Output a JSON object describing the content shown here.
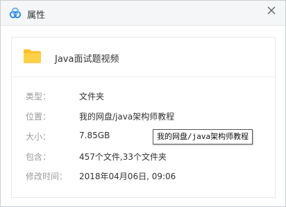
{
  "window": {
    "title": "属性",
    "close_symbol": "✕"
  },
  "file": {
    "name": "Java面试题视频",
    "icon": "folder-icon",
    "icon_color": "#fcc12e"
  },
  "properties": [
    {
      "label": "类型：",
      "value": "文件夹"
    },
    {
      "label": "位置：",
      "value": "我的网盘/java架构师教程"
    },
    {
      "label": "大小：",
      "value": "7.85GB"
    },
    {
      "label": "包含：",
      "value": "457个文件,33个文件夹"
    },
    {
      "label": "修改时间：",
      "value": "2018年04月06日, 09:06"
    }
  ],
  "tooltip": {
    "text": "我的网盘/java架构师教程"
  },
  "colors": {
    "logo_blue": "#2e8ce0",
    "label_gray": "#999999",
    "title_bar": "#f5f6f7"
  }
}
